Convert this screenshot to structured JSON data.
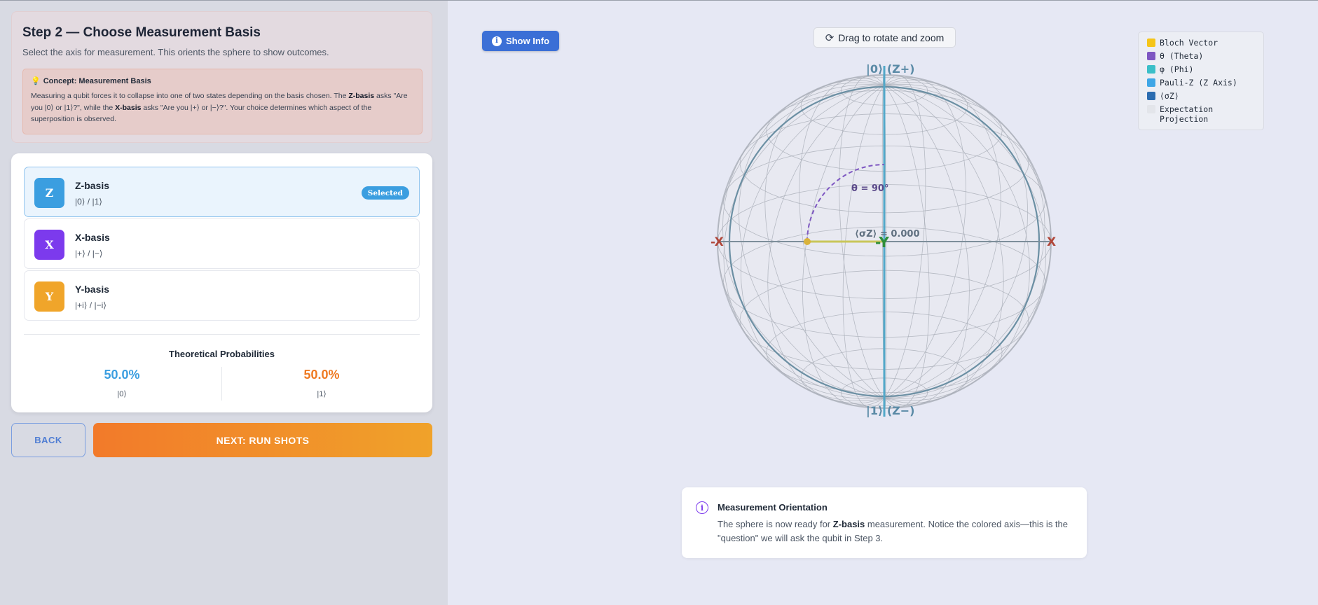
{
  "step": {
    "title": "Step 2 — Choose Measurement Basis",
    "subtitle": "Select the axis for measurement. This orients the sphere to show outcomes.",
    "concept_title": "Concept: Measurement Basis",
    "concept_body_1": "Measuring a qubit forces it to collapse into one of two states depending on the basis chosen. The ",
    "concept_bold_1": "Z-basis",
    "concept_body_2": " asks \"Are you |0⟩ or |1⟩?\", while the ",
    "concept_bold_2": "X-basis",
    "concept_body_3": " asks \"Are you |+⟩ or |−⟩?\". Your choice determines which aspect of the superposition is observed."
  },
  "bases": [
    {
      "letter": "Z",
      "name": "Z-basis",
      "states": "|0⟩ / |1⟩",
      "selected_label": "Selected"
    },
    {
      "letter": "X",
      "name": "X-basis",
      "states": "|+⟩ / |−⟩"
    },
    {
      "letter": "Y",
      "name": "Y-basis",
      "states": "|+i⟩ / |−i⟩"
    }
  ],
  "probabilities": {
    "title": "Theoretical Probabilities",
    "p0_value": "50.0%",
    "p0_label": "|0⟩",
    "p1_value": "50.0%",
    "p1_label": "|1⟩"
  },
  "buttons": {
    "back": "BACK",
    "next": "NEXT: RUN SHOTS",
    "show_info": "Show Info",
    "drag_hint": "Drag to rotate and zoom"
  },
  "legend": [
    {
      "label": "Bloch Vector",
      "color": "#f5c518"
    },
    {
      "label": "θ (Theta)",
      "color": "#7e57c2"
    },
    {
      "label": "φ (Phi)",
      "color": "#3bbfc8"
    },
    {
      "label": "Pauli-Z (Z Axis)",
      "color": "#3ea6e6"
    },
    {
      "label": "⟨σZ⟩",
      "color": "#2b6cb0"
    },
    {
      "label": "Expectation Projection",
      "color": "#e3e5ea"
    }
  ],
  "sphere": {
    "top_label": "|0⟩ (Z+)",
    "bottom_label": "|1⟩ (Z−)",
    "x_pos": "X",
    "x_neg": "-X",
    "y_label": "-Y",
    "theta_label": "θ = 90°",
    "expectation_label": "⟨σZ⟩ = 0.000"
  },
  "orientation": {
    "title": "Measurement Orientation",
    "body_1": "The sphere is now ready for ",
    "body_bold": "Z-basis",
    "body_2": " measurement. Notice the colored axis—this is the \"question\" we will ask the qubit in Step 3."
  }
}
